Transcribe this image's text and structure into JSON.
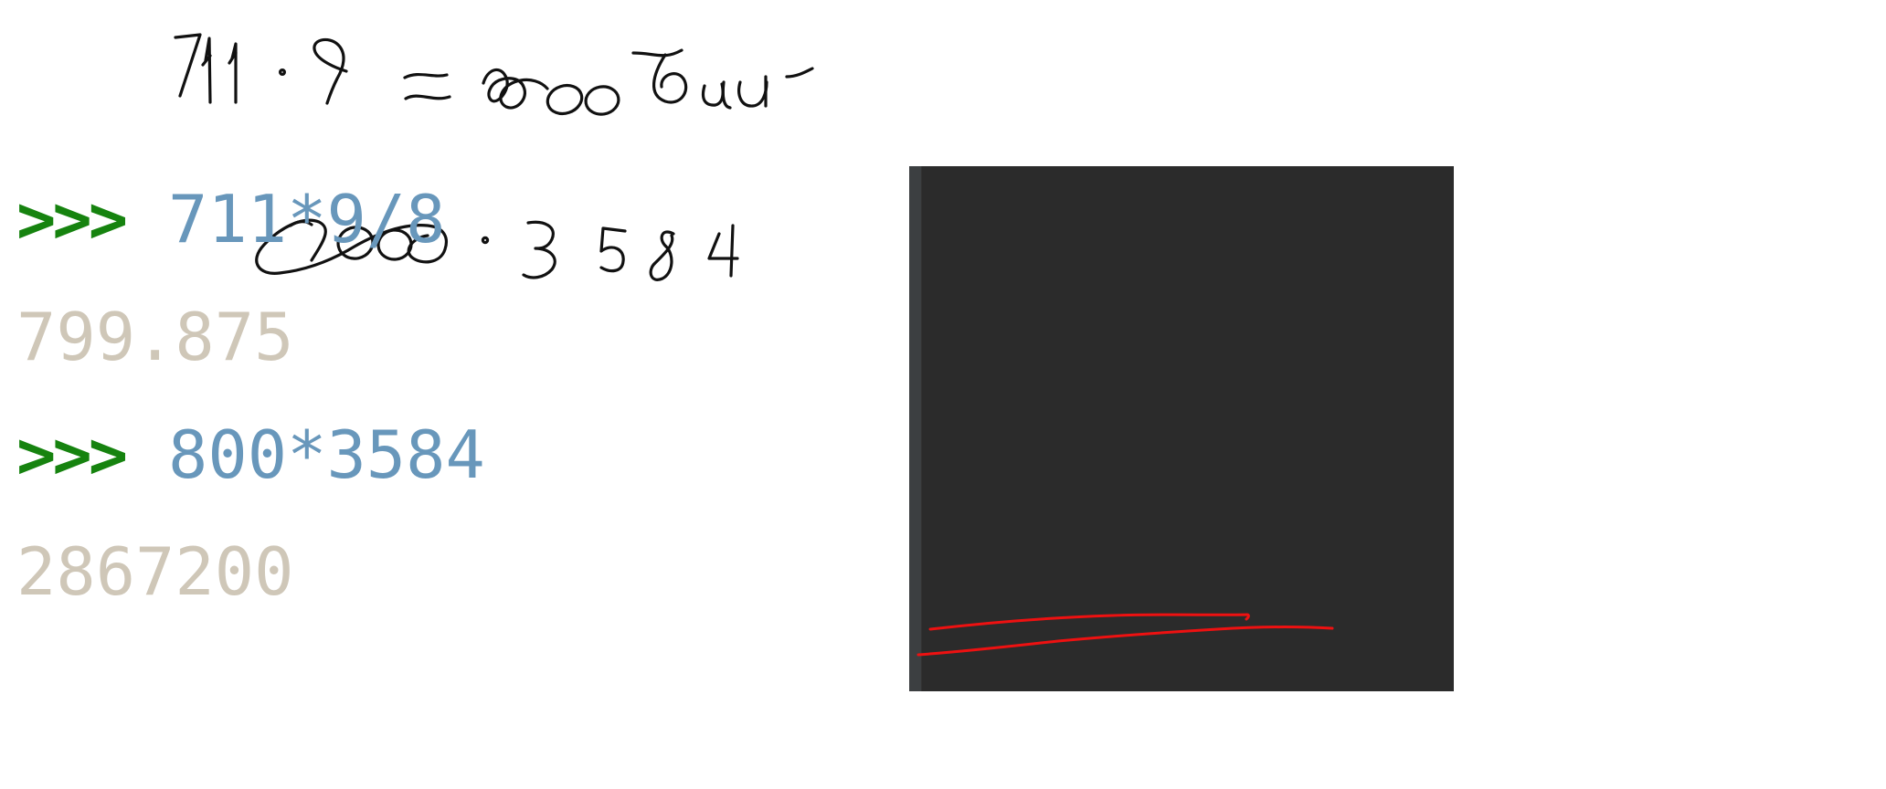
{
  "whiteboard": {
    "handwritten_line_1": "711 · 9 ≈ 800 бит",
    "handwritten_line_2": "800 · 3584"
  },
  "console": {
    "prompt_symbol": ">>>",
    "entries": [
      {
        "command": "711*9/8",
        "result": "799.875"
      },
      {
        "command": "800*3584",
        "result": "2867200"
      }
    ]
  },
  "colors": {
    "console_background": "#2b2b2b",
    "prompt": "#16830f",
    "command": "#6897bb",
    "result": "#cfc7b8",
    "annotation_underline": "#ee1111",
    "ink": "#111111"
  },
  "icons": {
    "annotation": "red-underline-mark"
  }
}
